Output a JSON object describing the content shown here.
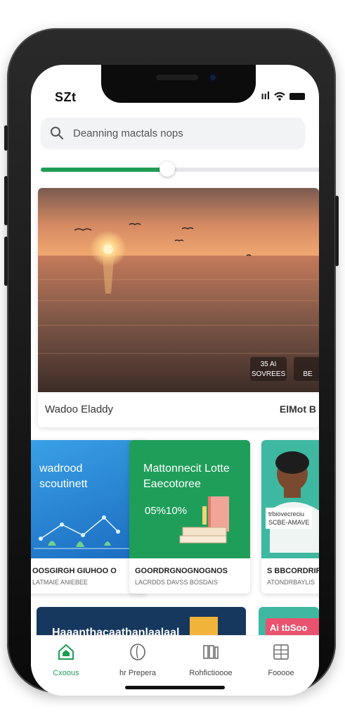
{
  "status": {
    "time": "SZt",
    "signal": "ııl"
  },
  "search": {
    "placeholder": "Deanning mactals nops"
  },
  "slider": {
    "value": 0.45
  },
  "hero": {
    "caption": "Wadoo Eladdy",
    "meta": "ElMot B",
    "badges": [
      {
        "line1": "35 AI",
        "line2": "SOVREES"
      },
      {
        "line1": "",
        "line2": "BE"
      }
    ]
  },
  "cards": [
    {
      "title_line1": "wadrood",
      "title_line2": "scoutinett",
      "line1": "OOSGIRGH GIUHOO O",
      "line2": "LATMAIE ANIEBEE",
      "color": "#2f8fd8"
    },
    {
      "title_line1": "Mattonnecit Lotte",
      "title_line2": "Eaecotoree",
      "art_text": "05%10%",
      "line1": "GOORDRGNOGNOGNOS",
      "line2": "LACRDDS DAVSS BOSDAIS",
      "color": "#1f9e5a"
    },
    {
      "title_line1": "",
      "title_line2": "",
      "art_text_1": "trbiovecreciu",
      "art_text_2": "SCBE-AMAVE",
      "line1": "S BBCORDRIRS",
      "line2": "ATONDRBAYLIS",
      "color": "#3fb8a1"
    }
  ],
  "banners": [
    {
      "text": "Haaanthacaathanlaalaal",
      "color": "#16385e"
    },
    {
      "text": "Ai tbSoo",
      "color": "#e9536f"
    }
  ],
  "tabs": [
    {
      "label": "Cxoous",
      "icon": "home-icon",
      "active": true
    },
    {
      "label": "hr Prepera",
      "icon": "leaf-icon",
      "active": false
    },
    {
      "label": "Rohfictioooe",
      "icon": "library-icon",
      "active": false
    },
    {
      "label": "Fooooe",
      "icon": "grid-icon",
      "active": false
    }
  ],
  "colors": {
    "accent": "#1f9d55",
    "search_bg": "#f2f3f5"
  }
}
